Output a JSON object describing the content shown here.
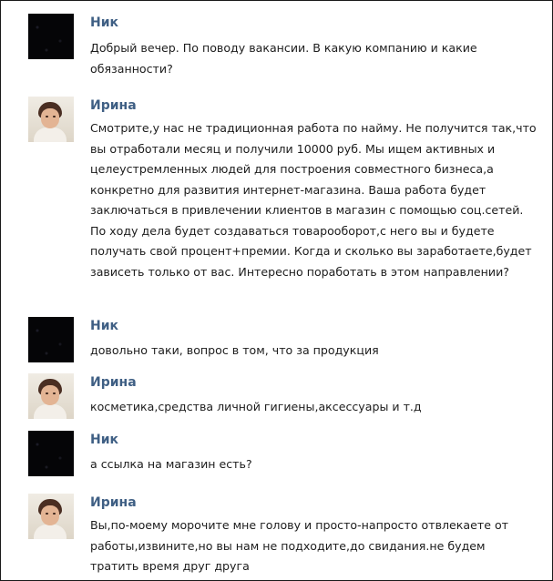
{
  "messages": [
    {
      "sender": "Ник",
      "avatar": "dark-avatar",
      "text": "Добрый вечер. По поводу вакансии. В какую компанию и какие обязанности?"
    },
    {
      "sender": "Ирина",
      "avatar": "child-photo-avatar",
      "text": "Смотрите,у нас не традиционная работа по найму. Не получится так,что вы отработали месяц и получили 10000 руб. Мы ищем активных и целеустремленных людей для построения совместного бизнеса,а конкретно для развития интернет-магазина. Ваша работа будет заключаться в привлечении клиентов в магазин с помощью соц.сетей. По ходу дела будет создаваться товарооборот,с него вы и будете получать свой процент+премии. Когда и сколько вы заработаете,будет зависеть только от вас. Интересно поработать в этом направлении?"
    },
    {
      "sender": "Ник",
      "avatar": "dark-avatar",
      "text": "довольно таки, вопрос в том, что за продукция"
    },
    {
      "sender": "Ирина",
      "avatar": "child-photo-avatar",
      "text": "косметика,средства личной гигиены,аксессуары и т.д"
    },
    {
      "sender": "Ник",
      "avatar": "dark-avatar",
      "text": "а ссылка на магазин есть?"
    },
    {
      "sender": "Ирина",
      "avatar": "child-photo-avatar",
      "text": "Вы,по-моему морочите мне голову и просто-напросто отвлекаете от работы,извините,но вы нам не подходите,до свидания.не будем тратить время друг друга"
    }
  ]
}
